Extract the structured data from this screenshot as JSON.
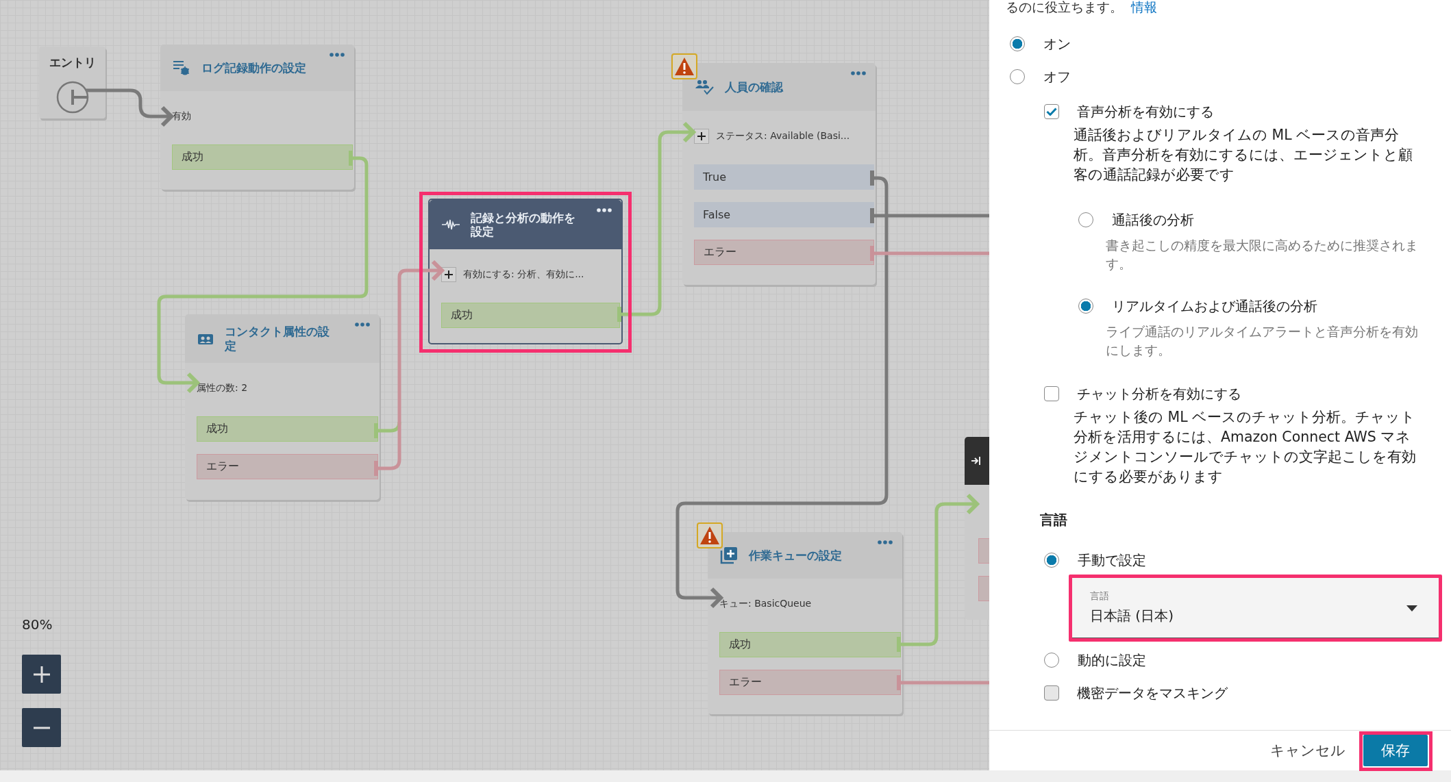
{
  "flow_nodes": [
    {
      "kind": "entry",
      "title": "エントリ"
    },
    {
      "kind": "action",
      "title": "ログ記録動作の設定",
      "selected": false,
      "warning": false,
      "detail": {
        "text": "有効",
        "expandable": false
      },
      "branches": [
        {
          "label": "成功",
          "kind": "success"
        }
      ]
    },
    {
      "kind": "action",
      "title": "コンタクト属性の設定",
      "selected": false,
      "warning": false,
      "detail": {
        "text": "属性の数: 2",
        "expandable": false
      },
      "branches": [
        {
          "label": "成功",
          "kind": "success"
        },
        {
          "label": "エラー",
          "kind": "error"
        }
      ]
    },
    {
      "kind": "action",
      "title": "記録と分析の動作を設定",
      "selected": true,
      "highlighted": true,
      "warning": false,
      "detail": {
        "text": "有効にする: 分析、有効に...",
        "expandable": true
      },
      "branches": [
        {
          "label": "成功",
          "kind": "success"
        }
      ]
    },
    {
      "kind": "action",
      "title": "人員の確認",
      "selected": false,
      "warning": true,
      "detail": {
        "text": "ステータス: Available (Basi...",
        "expandable": true
      },
      "branches": [
        {
          "label": "True",
          "kind": "condition"
        },
        {
          "label": "False",
          "kind": "condition"
        },
        {
          "label": "エラー",
          "kind": "error"
        }
      ]
    },
    {
      "kind": "action",
      "title": "作業キューの設定",
      "selected": false,
      "warning": true,
      "detail": {
        "text": "キュー: BasicQueue",
        "expandable": false
      },
      "branches": [
        {
          "label": "成功",
          "kind": "success"
        },
        {
          "label": "エラー",
          "kind": "error"
        }
      ]
    },
    {
      "kind": "partial",
      "branches": [
        {
          "kind": "error"
        },
        {
          "kind": "error"
        }
      ]
    }
  ],
  "zoom": {
    "percent": "80%"
  },
  "settings_panel": {
    "intro": {
      "text": "るのに役立ちます。",
      "link": "情報"
    },
    "analytics_mode": [
      {
        "label": "オン",
        "selected": true
      },
      {
        "label": "オフ",
        "selected": false
      }
    ],
    "voice_analytics": {
      "label": "音声分析を有効にする",
      "checked": true,
      "description": "通話後およびリアルタイムの ML ベースの音声分析。音声分析を有効にするには、エージェントと顧客の通話記録が必要です",
      "options": [
        {
          "label": "通話後の分析",
          "hint": "書き起こしの精度を最大限に高めるために推奨されます。",
          "selected": false
        },
        {
          "label": "リアルタイムおよび通話後の分析",
          "hint": "ライブ通話のリアルタイムアラートと音声分析を有効にします。",
          "selected": true
        }
      ]
    },
    "chat_analytics": {
      "label": "チャット分析を有効にする",
      "checked": false,
      "description": "チャット後の ML ベースのチャット分析。チャット分析を活用するには、Amazon Connect AWS マネジメントコンソールでチャットの文字起こしを有効にする必要があります"
    },
    "language": {
      "heading": "言語",
      "options": [
        {
          "label": "手動で設定",
          "selected": true
        },
        {
          "label": "動的に設定",
          "selected": false
        }
      ],
      "select": {
        "label": "言語",
        "value": "日本語 (日本)",
        "highlighted": true
      }
    },
    "redaction": {
      "label": "機密データをマスキング",
      "checked": false
    },
    "footer": {
      "cancel": "キャンセル",
      "save": {
        "label": "保存",
        "highlighted": true
      }
    }
  }
}
